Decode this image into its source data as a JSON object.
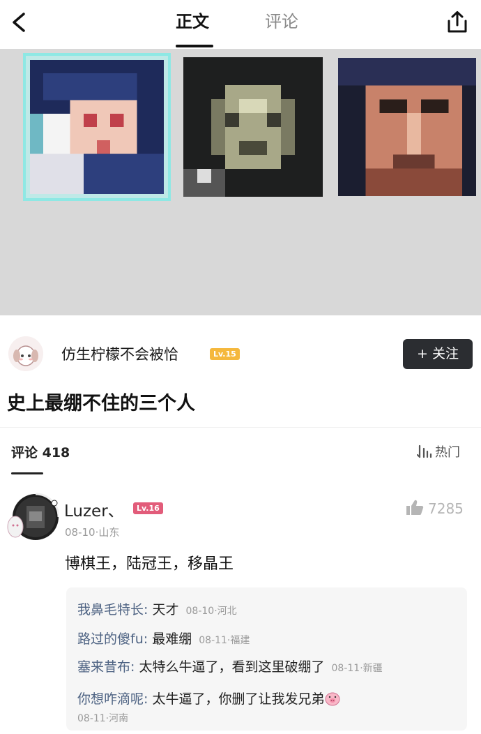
{
  "nav": {
    "tab_main": "正文",
    "tab_comments": "评论"
  },
  "gallery": {
    "images": [
      "pixel-portrait-1",
      "pixel-portrait-2",
      "pixel-portrait-3"
    ],
    "selected_index": 0,
    "selected_border_color": "#8ee8e4"
  },
  "author": {
    "name": "仿生柠檬不会被恰",
    "level": "Lv.15",
    "follow_label": "+ 关注"
  },
  "post": {
    "title": "史上最绷不住的三个人"
  },
  "comments": {
    "header": "评论 418",
    "sort_label": "热门",
    "items": [
      {
        "user": "Luzer、",
        "level": "Lv.16",
        "likes": "7285",
        "meta": "08-10·山东",
        "text": "博棋王，陆冠王，移晶王",
        "replies": [
          {
            "user": "我鼻毛特长:",
            "text": "天才",
            "time": "08-10·河北"
          },
          {
            "user": "路过的傻fu:",
            "text": "最难绷",
            "time": "08-11·福建"
          },
          {
            "user": "塞来昔布:",
            "text": "太特么牛逼了，看到这里破绷了",
            "time": "08-11·新疆"
          },
          {
            "user": "你想咋滴呢:",
            "text": "太牛逼了，你删了让我发兄弟",
            "time": "08-11·河南"
          }
        ]
      }
    ]
  },
  "colors": {
    "level_orange": "#f5b83d",
    "level_red": "#e25c7a",
    "reply_user": "#4e6383",
    "follow_bg": "#2b2d31"
  }
}
